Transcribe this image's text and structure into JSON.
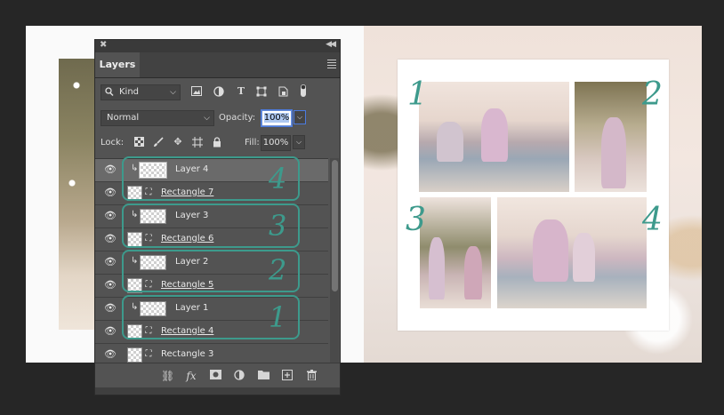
{
  "panel": {
    "tab_label": "Layers",
    "filter_kind": "Kind",
    "blend_mode": "Normal",
    "opacity_label": "Opacity:",
    "opacity_value": "100%",
    "lock_label": "Lock:",
    "fill_label": "Fill:",
    "fill_value": "100%"
  },
  "layers": [
    {
      "name": "Layer 4",
      "type": "clipped",
      "selected": true
    },
    {
      "name": "Rectangle 7",
      "type": "shape",
      "selected": false
    },
    {
      "name": "Layer 3",
      "type": "clipped",
      "selected": false
    },
    {
      "name": "Rectangle 6",
      "type": "shape",
      "selected": false
    },
    {
      "name": "Layer 2",
      "type": "clipped",
      "selected": false
    },
    {
      "name": "Rectangle 5",
      "type": "shape",
      "selected": false
    },
    {
      "name": "Layer 1",
      "type": "clipped",
      "selected": false
    },
    {
      "name": "Rectangle 4",
      "type": "shape",
      "selected": false
    },
    {
      "name": "Rectangle 3",
      "type": "shape",
      "selected": false
    }
  ],
  "group_annotations": [
    "4",
    "3",
    "2",
    "1"
  ],
  "collage_numbers": [
    "1",
    "2",
    "3",
    "4"
  ],
  "icons": {
    "filter": [
      "image-filter-icon",
      "adjustment-filter-icon",
      "type-filter-icon",
      "shape-filter-icon",
      "smartobject-filter-icon",
      "toggle-filter-icon"
    ],
    "lock": [
      "lock-transparent-icon",
      "lock-image-icon",
      "lock-position-icon",
      "lock-artboard-icon",
      "lock-all-icon"
    ],
    "footer": [
      "link-icon",
      "fx-icon",
      "mask-icon",
      "adjustment-icon",
      "folder-icon",
      "new-layer-icon",
      "trash-icon"
    ]
  },
  "colors": {
    "accent": "#3d9a8c",
    "panel_bg": "#535353",
    "selected_row": "#6a6a6a",
    "app_bg": "#262626"
  }
}
